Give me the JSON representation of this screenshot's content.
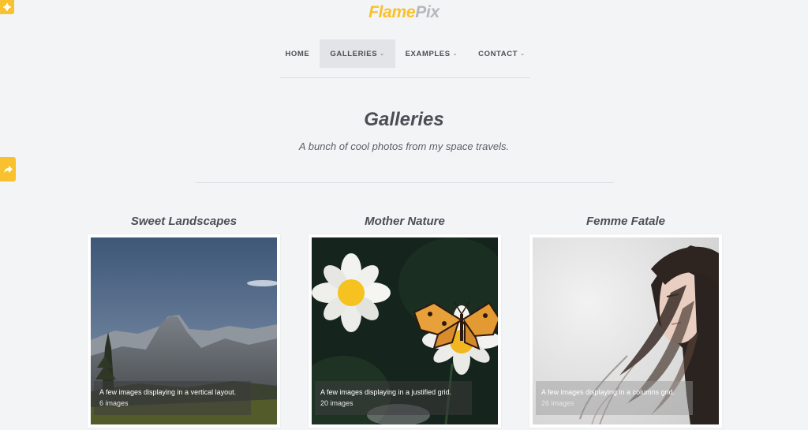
{
  "brand": {
    "part1": "Flame",
    "part2": "Pix"
  },
  "nav": {
    "items": [
      {
        "label": "HOME"
      },
      {
        "label": "GALLERIES"
      },
      {
        "label": "EXAMPLES"
      },
      {
        "label": "CONTACT"
      }
    ]
  },
  "page": {
    "title": "Galleries",
    "subtitle": "A bunch of cool photos from my space travels."
  },
  "galleries": [
    {
      "title": "Sweet Landscapes",
      "description": "A few images displaying in a vertical layout.",
      "count": "6 images"
    },
    {
      "title": "Mother Nature",
      "description": "A few images displaying in a justified grid.",
      "count": "20 images"
    },
    {
      "title": "Femme Fatale",
      "description": "A few images displaying in a columns grid.",
      "count": "26 images"
    }
  ],
  "icons": {
    "settings": "gear-icon",
    "share": "share-arrow-icon",
    "dropdown": "chevron-down-icon"
  },
  "colors": {
    "accent": "#f8c12d",
    "brand_secondary": "#b3b8be",
    "text": "#4a4f55",
    "background": "#f3f4f6"
  }
}
